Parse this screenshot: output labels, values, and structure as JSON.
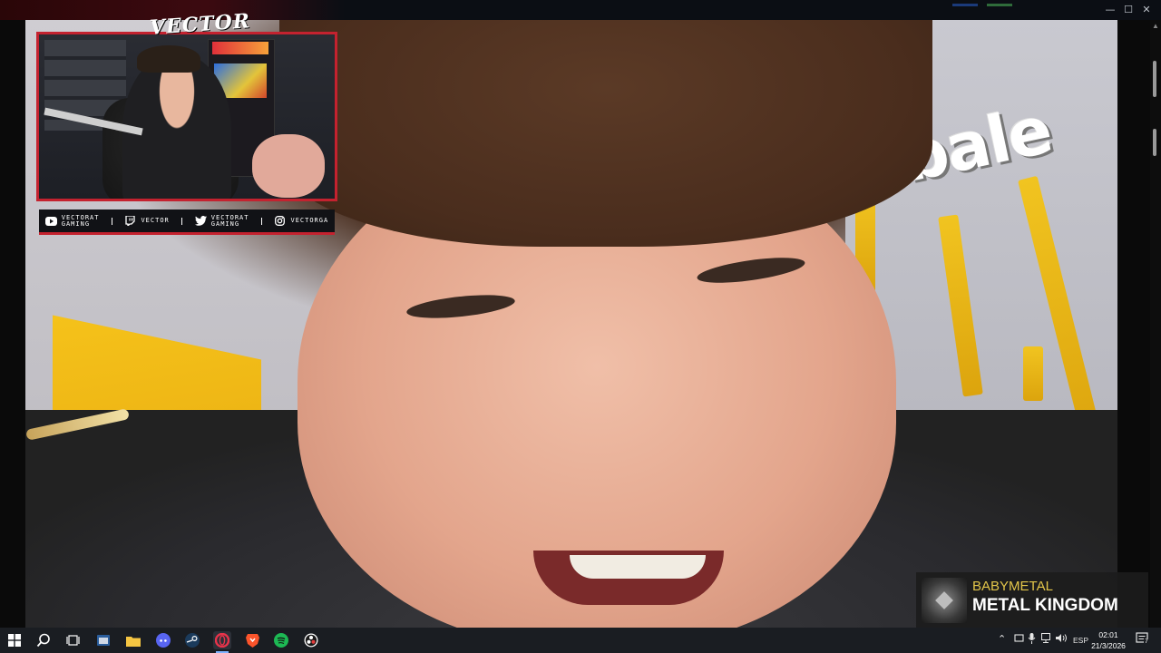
{
  "window": {
    "controls": {
      "minimize": "—",
      "maximize": "☐",
      "close": "✕"
    }
  },
  "stream_overlay": {
    "watermark": "VECTOR",
    "socials": [
      {
        "icon": "youtube-icon",
        "lines": [
          "VECTORAT",
          "GAMING"
        ]
      },
      {
        "icon": "twitch-icon",
        "lines": [
          "VECTOR"
        ]
      },
      {
        "icon": "twitter-icon",
        "lines": [
          "VECTORAT",
          "GAMING"
        ]
      },
      {
        "icon": "instagram-icon",
        "lines": [
          "VECTORGA"
        ]
      }
    ]
  },
  "video": {
    "sign_text": "bale"
  },
  "now_playing": {
    "artist": "BABYMETAL",
    "song": "METAL KINGDOM"
  },
  "taskbar": {
    "tray": {
      "language": "ESP",
      "time": "02:01",
      "date": "21/3/2026",
      "notification_count": "7"
    }
  },
  "colors": {
    "overlay_accent": "#c4222f",
    "artist_text": "#e3c64a",
    "taskbar_bg": "#1a1d22"
  }
}
